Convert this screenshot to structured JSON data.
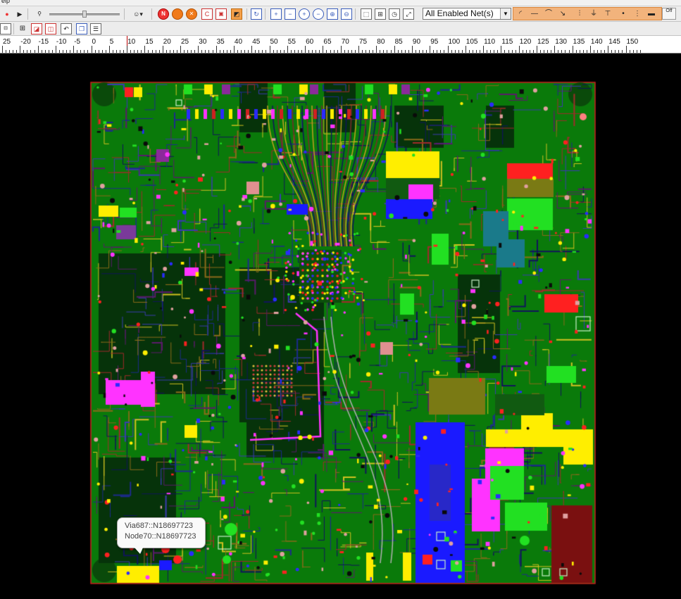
{
  "menu": {
    "label": "elp"
  },
  "toolbar": {
    "layer_icons": [
      "N",
      "",
      "",
      "C",
      "",
      "",
      "",
      ""
    ],
    "net_selector": {
      "value": "All Enabled Net(s)"
    },
    "off_label": "Off",
    "slider_value": 0.5
  },
  "ruler": {
    "labels": [
      "25",
      "-20",
      "-15",
      "-10",
      "-5",
      "0",
      "5",
      "10",
      "15",
      "20",
      "25",
      "30",
      "35",
      "40",
      "45",
      "50",
      "55",
      "60",
      "65",
      "70",
      "75",
      "80",
      "85",
      "90",
      "95",
      "100",
      "105",
      "110",
      "115",
      "120",
      "125",
      "130",
      "135",
      "140",
      "145",
      "150"
    ]
  },
  "tooltip": {
    "line1": "Via687::N18697723",
    "line2": "Node70::N18697723"
  },
  "colors": {
    "board": "#0a7a0a",
    "board_edge": "#c81e1e",
    "trace_dark": "#10145a",
    "yellow": "#ffee00",
    "magenta": "#ff33ff",
    "blue": "#1a1aff",
    "red": "#ff2020",
    "teal": "#1a7a8a",
    "olive": "#7a7a14",
    "bright_green": "#22e022",
    "maroon": "#7a1010"
  }
}
